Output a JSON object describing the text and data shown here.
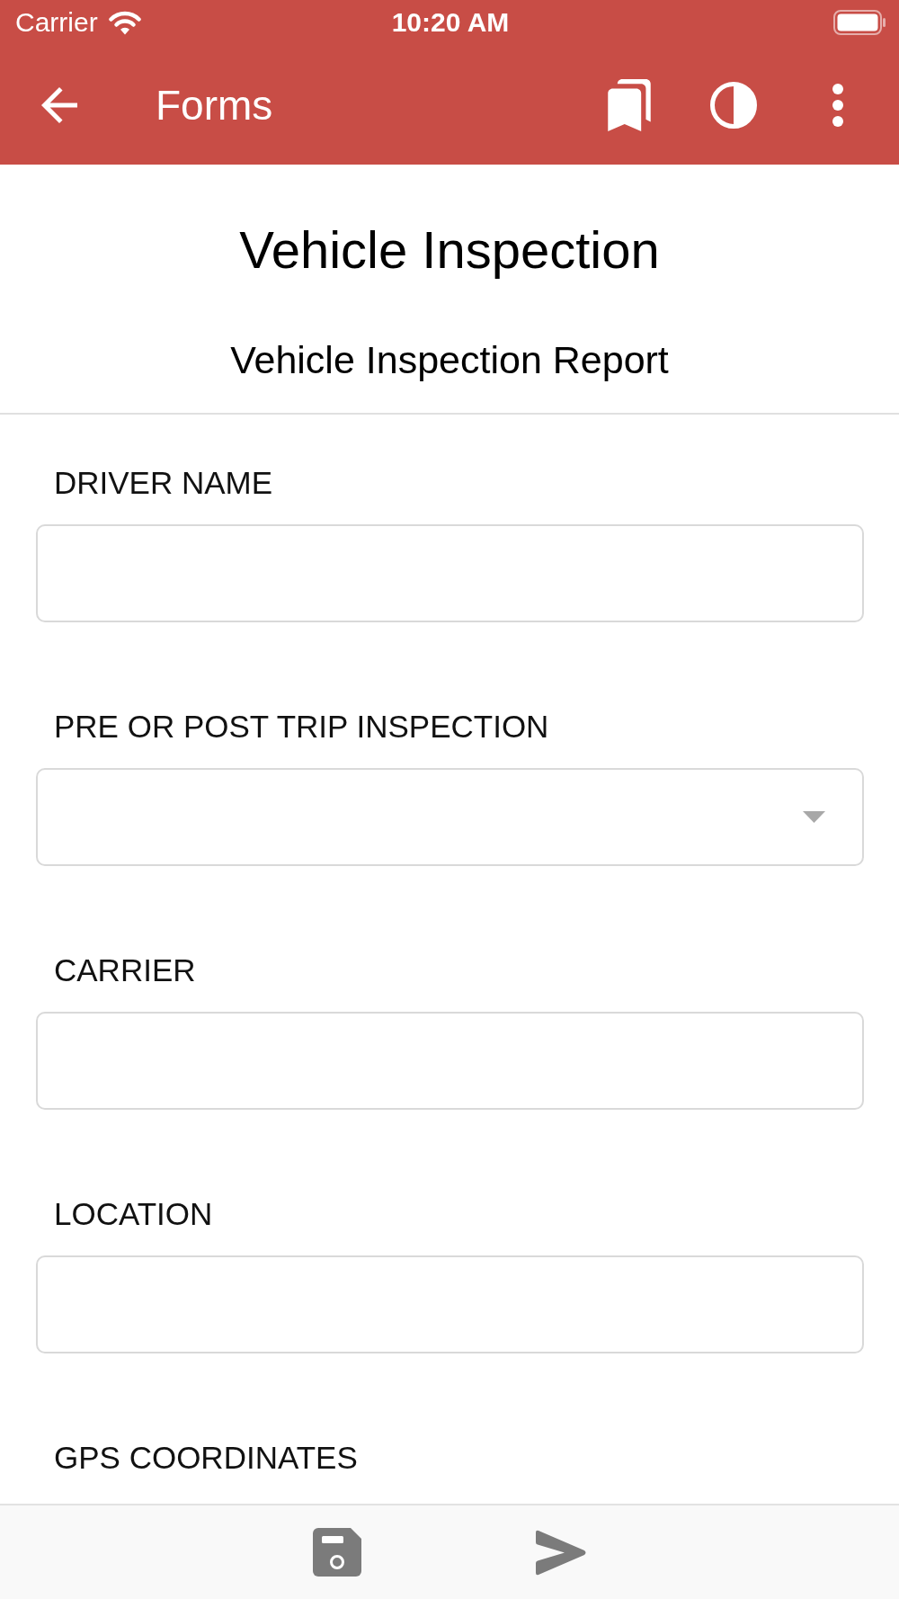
{
  "status_bar": {
    "carrier": "Carrier",
    "time": "10:20 AM"
  },
  "app_bar": {
    "title": "Forms"
  },
  "form": {
    "title": "Vehicle Inspection",
    "subtitle": "Vehicle Inspection Report",
    "fields": [
      {
        "label": "DRIVER NAME",
        "kind": "text"
      },
      {
        "label": "PRE OR POST TRIP INSPECTION",
        "kind": "select"
      },
      {
        "label": "CARRIER",
        "kind": "text"
      },
      {
        "label": "LOCATION",
        "kind": "text"
      },
      {
        "label": "GPS COORDINATES",
        "kind": "label"
      }
    ]
  }
}
